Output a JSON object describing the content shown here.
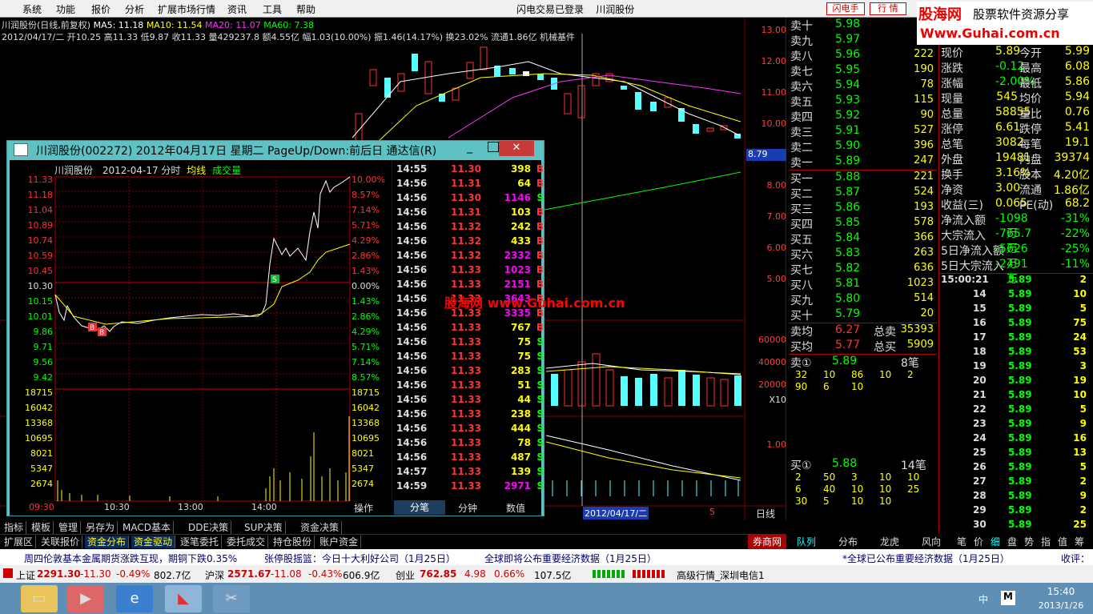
{
  "menu": {
    "items": [
      "系统",
      "功能",
      "报价",
      "分析",
      "扩展市场行情",
      "资讯",
      "工具",
      "帮助"
    ],
    "center": "闪电交易已登录    川润股份",
    "btn_flash": "闪电手",
    "btn_quote": "行 情"
  },
  "logo": {
    "brand": "股海网",
    "slogan": "股票软件资源分享",
    "url": "Www.Guhai.com.cn"
  },
  "chart": {
    "title": "川润股份(日线,前复权)",
    "ma5": "MA5: 11.18",
    "ma10": "MA10: 11.54",
    "ma20": "MA20: 11.07",
    "ma60": "MA60: 7.38",
    "info": "2012/04/17/二 开10.25 高11.33 低9.87 收11.33 量429237.8 额4.55亿 幅1.03(10.00%) 振1.46(14.17%) 换23.02% 流通1.86亿 机械基件",
    "y_price": [
      "13.00",
      "12.00",
      "11.00",
      "10.00",
      "8.79",
      "8.00",
      "7.00",
      "6.00",
      "5.00"
    ],
    "y_vol": [
      "60000",
      "40000",
      "20000",
      "X10"
    ],
    "y_macd": "1.00",
    "date_label": "2012/04/17/二",
    "tab_dayline": "日线",
    "page": "5",
    "watermark": "股海网 www.Guhai.com.cn"
  },
  "dialog": {
    "title": "川润股份(002272) 2012年04月17日 星期二 PageUp/Down:前后日 通达信(R)",
    "sub_name": "川润股份",
    "sub_date": "2012-04-17 分时",
    "sub_avg": "均线",
    "sub_vol": "成交量",
    "price_left": [
      "11.33",
      "11.18",
      "11.04",
      "10.89",
      "10.74",
      "10.59",
      "10.45",
      "10.30",
      "10.15",
      "10.01",
      "9.86",
      "9.71",
      "9.56",
      "9.42"
    ],
    "pct_right": [
      "10.00%",
      "8.57%",
      "7.14%",
      "5.71%",
      "4.29%",
      "2.86%",
      "1.43%",
      "0.00%",
      "1.43%",
      "2.86%",
      "4.29%",
      "5.71%",
      "7.14%",
      "8.57%"
    ],
    "vol_left": [
      "18715",
      "16042",
      "13368",
      "10695",
      "8021",
      "5347",
      "2674"
    ],
    "times": [
      "09:30",
      "10:30",
      "13:00",
      "14:00"
    ],
    "tabs": [
      "操作",
      "分笔",
      "分钟",
      "数值"
    ],
    "ticks": [
      [
        "14:55",
        "11.30",
        "398",
        "B"
      ],
      [
        "14:56",
        "11.31",
        "64",
        "B"
      ],
      [
        "14:56",
        "11.30",
        "1146",
        "S"
      ],
      [
        "14:56",
        "11.31",
        "103",
        "B"
      ],
      [
        "14:56",
        "11.32",
        "242",
        "B"
      ],
      [
        "14:56",
        "11.32",
        "433",
        "B"
      ],
      [
        "14:56",
        "11.32",
        "2332",
        "B"
      ],
      [
        "14:56",
        "11.33",
        "1023",
        "B"
      ],
      [
        "14:56",
        "11.33",
        "2151",
        "B"
      ],
      [
        "14:56",
        "11.33",
        "3643",
        "B"
      ],
      [
        "14:56",
        "11.33",
        "3335",
        "B"
      ],
      [
        "14:56",
        "11.33",
        "767",
        "B"
      ],
      [
        "14:56",
        "11.33",
        "75",
        "S"
      ],
      [
        "14:56",
        "11.33",
        "75",
        "S"
      ],
      [
        "14:56",
        "11.33",
        "283",
        "S"
      ],
      [
        "14:56",
        "11.33",
        "51",
        "S"
      ],
      [
        "14:56",
        "11.33",
        "44",
        "S"
      ],
      [
        "14:56",
        "11.33",
        "238",
        "S"
      ],
      [
        "14:56",
        "11.33",
        "444",
        "S"
      ],
      [
        "14:56",
        "11.33",
        "78",
        "S"
      ],
      [
        "14:56",
        "11.33",
        "487",
        "S"
      ],
      [
        "14:57",
        "11.33",
        "139",
        "S"
      ],
      [
        "14:59",
        "11.33",
        "2971",
        "S"
      ]
    ]
  },
  "orderbook": {
    "sell": [
      [
        "卖十",
        "5.98",
        ""
      ],
      [
        "卖九",
        "5.97",
        ""
      ],
      [
        "卖八",
        "5.96",
        "222"
      ],
      [
        "卖七",
        "5.95",
        "190"
      ],
      [
        "卖六",
        "5.94",
        "78"
      ],
      [
        "卖五",
        "5.93",
        "115"
      ],
      [
        "卖四",
        "5.92",
        "90"
      ],
      [
        "卖三",
        "5.91",
        "527"
      ],
      [
        "卖二",
        "5.90",
        "396"
      ],
      [
        "卖一",
        "5.89",
        "247"
      ]
    ],
    "buy": [
      [
        "买一",
        "5.88",
        "221"
      ],
      [
        "买二",
        "5.87",
        "524"
      ],
      [
        "买三",
        "5.86",
        "193"
      ],
      [
        "买四",
        "5.85",
        "578"
      ],
      [
        "买五",
        "5.84",
        "366"
      ],
      [
        "买六",
        "5.83",
        "263"
      ],
      [
        "买七",
        "5.82",
        "636"
      ],
      [
        "买八",
        "5.81",
        "1023"
      ],
      [
        "买九",
        "5.80",
        "514"
      ],
      [
        "买十",
        "5.79",
        "20"
      ]
    ],
    "avg": [
      [
        "卖均",
        "6.27",
        "总卖",
        "35393"
      ],
      [
        "买均",
        "5.77",
        "总买",
        "5909"
      ]
    ],
    "sell_queue_label": "卖①",
    "sell_queue_price": "5.89",
    "sell_queue_count": "8笔",
    "sell_queue": [
      "32",
      "10",
      "86",
      "10",
      "2",
      "90",
      "6",
      "10"
    ],
    "buy_queue_label": "买①",
    "buy_queue_price": "5.88",
    "buy_queue_count": "14笔",
    "buy_queue": [
      "2",
      "50",
      "3",
      "10",
      "10",
      "6",
      "40",
      "10",
      "10",
      "25",
      "30",
      "5",
      "10",
      "10"
    ]
  },
  "stats": [
    [
      "现价",
      "5.89",
      "今开",
      "5.99"
    ],
    [
      "涨跌",
      "-0.12",
      "最高",
      "6.08"
    ],
    [
      "涨幅",
      "-2.00%",
      "最低",
      "5.86"
    ],
    [
      "现量",
      "545",
      "均价",
      "5.94"
    ],
    [
      "总量",
      "58855",
      "量比",
      "0.76"
    ],
    [
      "涨停",
      "6.61",
      "跌停",
      "5.41"
    ],
    [
      "总笔",
      "3082",
      "每笔",
      "19.1"
    ],
    [
      "外盘",
      "19481",
      "内盘",
      "39374"
    ],
    [
      "换手",
      "3.16%",
      "股本",
      "4.20亿"
    ],
    [
      "净资",
      "3.00",
      "流通",
      "1.86亿"
    ],
    [
      "收益(三)",
      "0.065",
      "PE(动)",
      "68.2"
    ],
    [
      "净流入额",
      "-1098万",
      "",
      "-31%"
    ],
    [
      "大宗流入",
      "-765.7万",
      "",
      "-22%"
    ],
    [
      "5日净流入额",
      "-5626万",
      "",
      "-25%"
    ],
    [
      "5日大宗流入",
      "-2491万",
      "",
      "-11%"
    ]
  ],
  "ticks_right": [
    [
      "15:00:21",
      "5.89",
      "2"
    ],
    [
      "14",
      "5.89",
      "10"
    ],
    [
      "15",
      "5.89",
      "5"
    ],
    [
      "16",
      "5.89",
      "75"
    ],
    [
      "17",
      "5.89",
      "24"
    ],
    [
      "18",
      "5.89",
      "53"
    ],
    [
      "19",
      "5.89",
      "3"
    ],
    [
      "20",
      "5.89",
      "19"
    ],
    [
      "21",
      "5.89",
      "10"
    ],
    [
      "22",
      "5.89",
      "5"
    ],
    [
      "23",
      "5.89",
      "9"
    ],
    [
      "24",
      "5.89",
      "16"
    ],
    [
      "25",
      "5.89",
      "13"
    ],
    [
      "26",
      "5.89",
      "5"
    ],
    [
      "27",
      "5.89",
      "2"
    ],
    [
      "28",
      "5.89",
      "9"
    ],
    [
      "29",
      "5.89",
      "2"
    ],
    [
      "30",
      "5.89",
      "25"
    ]
  ],
  "bottom_tabs": {
    "row1": [
      "指标",
      "模板",
      "管理",
      "另存为",
      "MACD基本",
      "DDE决策",
      "SUP决策",
      "资金决策"
    ],
    "row2": [
      "扩展区",
      "关联报价",
      "资金分布",
      "资金驱动",
      "逐笔委托",
      "委托成交",
      "持仓股份",
      "账户资金"
    ],
    "brand": "券商网"
  },
  "right_tabs": {
    "left": [
      "队列",
      "分布",
      "龙虎",
      "风向"
    ],
    "right": [
      "笔",
      "价",
      "细",
      "盘",
      "势",
      "指",
      "值",
      "筹"
    ]
  },
  "news": [
    "周四伦敦基本金属期货涨跌互现，期铜下跌0.35%",
    "张停股摇篮：今日十大利好公司（1月25日）",
    "全球即将公布重要经济数据（1月25日）",
    "*全球已公布重要经济数据（1月25日）",
    "收评：期"
  ],
  "status": {
    "sh_label": "上证",
    "sh": "2291.30",
    "sh_chg": "-11.30",
    "sh_pct": "-0.49%",
    "sh_amt": "802.7亿",
    "sz_label": "沪深",
    "sz": "2571.67",
    "sz_chg": "-11.08",
    "sz_pct": "-0.43%",
    "sz_amt": "606.9亿",
    "cy_label": "创业",
    "cy": "762.85",
    "cy_chg": "4.98",
    "cy_pct": "0.66%",
    "cy_amt": "107.5亿",
    "server": "高级行情_深圳电信1"
  },
  "taskbar": {
    "time": "15:40",
    "date": "2013/1/26",
    "ime": "中",
    "lang": "M"
  }
}
